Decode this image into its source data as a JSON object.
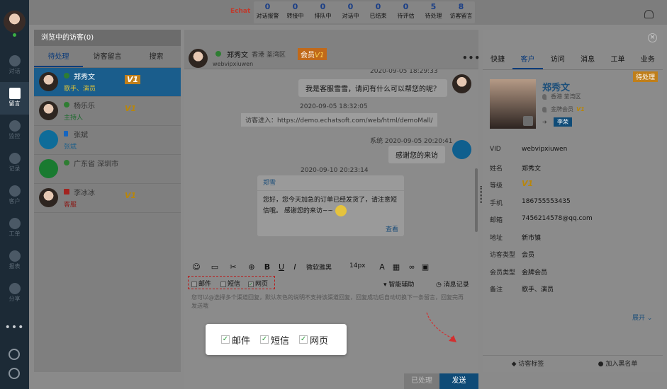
{
  "nav": {
    "items": [
      {
        "label": "对话",
        "icon": "chat-icon"
      },
      {
        "label": "留言",
        "icon": "mail-icon"
      },
      {
        "label": "监控",
        "icon": "eye-icon"
      },
      {
        "label": "记录",
        "icon": "clock-icon"
      },
      {
        "label": "客户",
        "icon": "contact-card-icon"
      },
      {
        "label": "工单",
        "icon": "clipboard-icon"
      },
      {
        "label": "报表",
        "icon": "chart-icon"
      },
      {
        "label": "分享",
        "icon": "share-icon"
      }
    ],
    "more": "•••"
  },
  "topbar": {
    "brand": "Echat",
    "stats": [
      {
        "num": "0",
        "label": "对话报警"
      },
      {
        "num": "0",
        "label": "转接中"
      },
      {
        "num": "0",
        "label": "排队中"
      },
      {
        "num": "0",
        "label": "对话中"
      },
      {
        "num": "0",
        "label": "已结束"
      },
      {
        "num": "0",
        "label": "待评估"
      },
      {
        "num": "5",
        "label": "待处理"
      },
      {
        "num": "8",
        "label": "访客留言"
      }
    ]
  },
  "visitors": {
    "title": "浏览中的访客(0)",
    "tabs": [
      "待处理",
      "访客留言",
      "搜索"
    ],
    "rows": [
      {
        "name": "郑秀文",
        "sub": "歌手、演员",
        "badge": "V1"
      },
      {
        "name": "杨乐乐",
        "sub": "主持人",
        "badge": "V1"
      },
      {
        "name": "张斌",
        "sub": "张斌",
        "badge": ""
      },
      {
        "name": "广东省 深圳市",
        "sub": "",
        "badge": ""
      },
      {
        "name": "李冰冰",
        "sub": "客服",
        "badge": "V1"
      }
    ]
  },
  "chat": {
    "name": "郑秀文",
    "location": "香港 荃湾区",
    "vip_label": "会员",
    "vip_level": "V1",
    "visitor_id": "webvipxiuwen",
    "messages": {
      "stamp1": "2020-09-05 18:29:33",
      "msg1": "我是客服雪雪，请问有什么可以帮您的呢？",
      "stamp2": "2020-09-05 18:32:05",
      "note": "访客进入：https://demo.echatsoft.com/web/html/demoMall/",
      "stamp3": "系统  2020-09-05 20:20:41",
      "msg3": "感谢您的来访",
      "stamp4": "2020-09-10 20:23:14",
      "card_title": "郑雪",
      "card_body": "您好，您今天加急的订单已经发货了，请注意短信哦。 感谢您的来访~~",
      "card_link": "查看"
    },
    "toolbar": {
      "font": "微软雅黑",
      "size": "14px"
    },
    "channels": [
      "邮件",
      "短信",
      "网页"
    ],
    "assist": "智能辅助",
    "history": "消息记录",
    "hint": "您可以@选择多个渠道回复，默认灰色的说明不支持该渠道回复，回复成功后自动切换下一条留言，回复完再发送哦",
    "btn_done": "已处理",
    "btn_send": "发送"
  },
  "popup": {
    "options": [
      "邮件",
      "短信",
      "网页"
    ]
  },
  "right": {
    "tabs": [
      "快捷",
      "客户",
      "访问",
      "消息",
      "工单",
      "业务"
    ],
    "pending": "待处理",
    "name": "郑秀文",
    "location": "香港 荃湾区",
    "level_text": "金牌会员",
    "level_badge": "V1",
    "tag": "李荣",
    "fields": [
      {
        "k": "VID",
        "v": "webvipxiuwen"
      },
      {
        "k": "姓名",
        "v": "郑秀文"
      },
      {
        "k": "等级",
        "v": "V1"
      },
      {
        "k": "手机",
        "v": "186755553435"
      },
      {
        "k": "邮箱",
        "v": "7456214578@qq.com"
      },
      {
        "k": "地址",
        "v": "新市镇"
      },
      {
        "k": "访客类型",
        "v": "会员"
      },
      {
        "k": "会员类型",
        "v": "金牌会员"
      },
      {
        "k": "备注",
        "v": "歌手、演员"
      }
    ],
    "expand": "展开 ⌄",
    "foot_left": "访客标签",
    "foot_right": "加入黑名单"
  }
}
